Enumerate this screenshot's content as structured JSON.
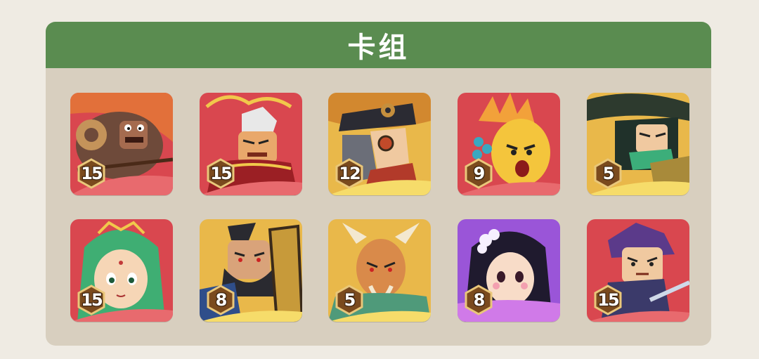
{
  "panel": {
    "title": "卡组"
  },
  "colors": {
    "background": "#efebe3",
    "panel": "#d8cfbf",
    "header": "#5a8c50",
    "red_card": "#d9474f",
    "gold_card": "#e9b84a",
    "purple_card": "#9a55d8",
    "badge": "#7a4a1e"
  },
  "cards": [
    {
      "level": "15",
      "rarity": "red",
      "portrait": "brown-armored-warrior"
    },
    {
      "level": "15",
      "rarity": "red",
      "portrait": "white-haired-general"
    },
    {
      "level": "12",
      "rarity": "gold",
      "portrait": "top-hat-goggles-hero"
    },
    {
      "level": "9",
      "rarity": "red",
      "portrait": "yellow-flame-creature"
    },
    {
      "level": "5",
      "rarity": "gold",
      "portrait": "masked-green-scarf-hero"
    },
    {
      "level": "15",
      "rarity": "red",
      "portrait": "green-haired-lady"
    },
    {
      "level": "8",
      "rarity": "gold",
      "portrait": "black-bearded-shield-warrior"
    },
    {
      "level": "5",
      "rarity": "gold",
      "portrait": "horned-old-sage"
    },
    {
      "level": "8",
      "rarity": "purple",
      "portrait": "black-haired-maiden"
    },
    {
      "level": "15",
      "rarity": "red",
      "portrait": "purple-haired-swordsman"
    }
  ]
}
